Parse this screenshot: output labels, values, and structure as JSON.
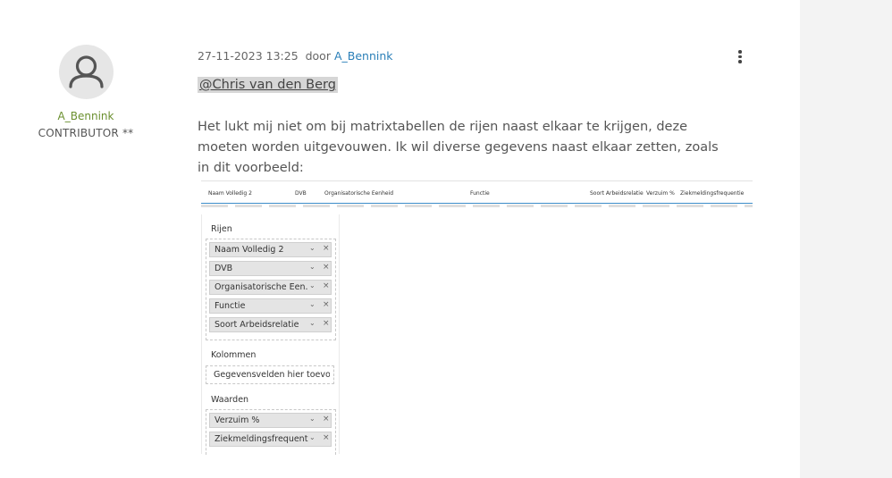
{
  "author": {
    "name": "A_Bennink",
    "role": "CONTRIBUTOR **"
  },
  "post": {
    "date": "27-11-2023 13:25",
    "by": "door",
    "author_link": "A_Bennink",
    "mention": "@Chris van den Berg",
    "body": "Het lukt mij niet om bij matrixtabellen de rijen naast elkaar te krijgen, deze moeten worden uitgevouwen. Ik wil diverse gegevens naast elkaar zetten, zoals  in dit voorbeeld:"
  },
  "embedded_screenshot": {
    "table_headers": [
      "Naam Volledig 2",
      "DVB",
      "Organisatorische Eenheid",
      "Functie",
      "Soort Arbeidsrelatie",
      "Verzuim %",
      "Ziekmeldingsfrequentie"
    ],
    "rows_label": "Rijen",
    "rows": [
      "Naam Volledig 2",
      "DVB",
      "Organisatorische Een...",
      "Functie",
      "Soort Arbeidsrelatie"
    ],
    "columns_label": "Kolommen",
    "columns_placeholder": "Gegevensvelden hier toevo...",
    "values_label": "Waarden",
    "values": [
      "Verzuim %",
      "Ziekmeldingsfrequentie"
    ]
  }
}
